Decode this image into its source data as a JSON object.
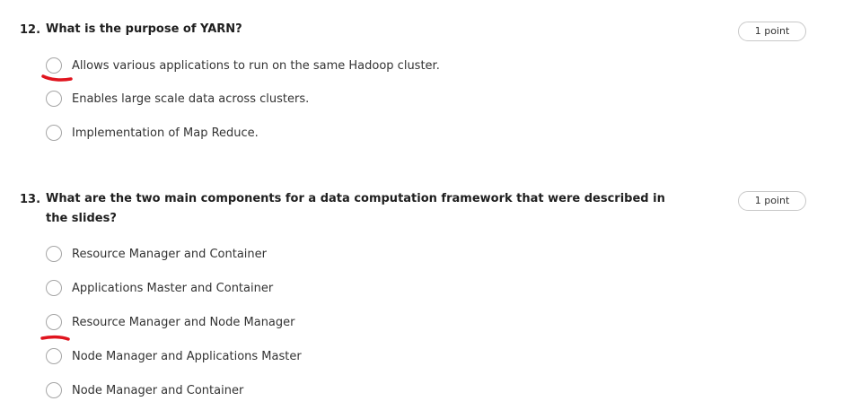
{
  "questions": [
    {
      "number": "12.",
      "prompt": "What is the purpose of YARN?",
      "points": "1 point",
      "options": [
        {
          "label": "Allows various applications to run on the same Hadoop cluster.",
          "marked": true
        },
        {
          "label": "Enables large scale data across clusters.",
          "marked": false
        },
        {
          "label": "Implementation of Map Reduce.",
          "marked": false
        }
      ]
    },
    {
      "number": "13.",
      "prompt": "What are the two main components for a data computation framework that were described in the slides?",
      "points": "1 point",
      "options": [
        {
          "label": "Resource Manager and Container",
          "marked": false
        },
        {
          "label": "Applications Master and Container",
          "marked": false
        },
        {
          "label": "Resource Manager and Node Manager",
          "marked": true
        },
        {
          "label": "Node Manager and Applications Master",
          "marked": false
        },
        {
          "label": "Node Manager and Container",
          "marked": false
        }
      ]
    }
  ],
  "colors": {
    "annotation": "#e0141e",
    "radio_border": "#a6a6a6",
    "points_border": "#c8c8c8"
  }
}
